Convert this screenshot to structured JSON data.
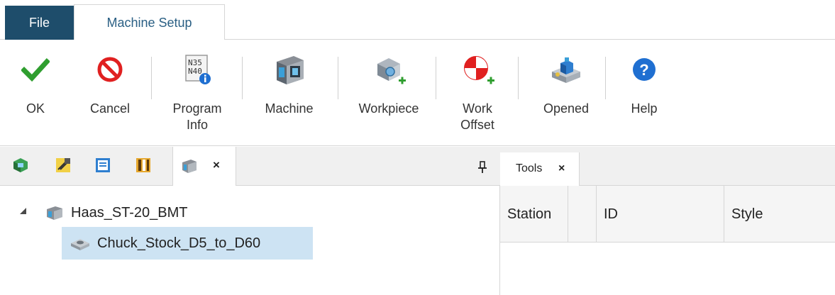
{
  "ribbon_tabs": {
    "file": "File",
    "machine_setup": "Machine Setup"
  },
  "ribbon": {
    "ok": "OK",
    "cancel": "Cancel",
    "program_info_line1": "Program",
    "program_info_line2": "Info",
    "program_info_icon_text1": "N35",
    "program_info_icon_text2": "N40",
    "machine": "Machine",
    "workpiece": "Workpiece",
    "work_offset_line1": "Work",
    "work_offset_line2": "Offset",
    "opened": "Opened",
    "help": "Help"
  },
  "left_pane": {
    "close": "×",
    "tree": {
      "root": "Haas_ST-20_BMT",
      "child": "Chuck_Stock_D5_to_D60"
    }
  },
  "right_pane": {
    "tab": "Tools",
    "close": "×",
    "columns": [
      "Station",
      "",
      "ID",
      "Style"
    ]
  },
  "colors": {
    "file_tab_bg": "#1e4d6b",
    "accent_blue": "#2a5f84",
    "ok_green": "#2f9e2f",
    "cancel_red": "#e02020",
    "help_blue": "#1f6fd1",
    "selection": "#cde3f3"
  }
}
